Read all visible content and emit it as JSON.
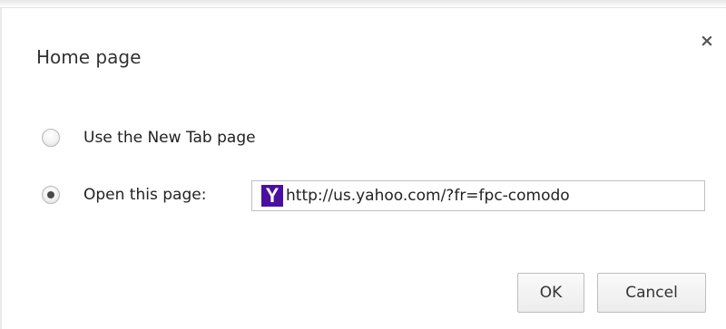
{
  "dialog": {
    "title": "Home page",
    "close_glyph": "×"
  },
  "options": [
    {
      "label": "Use the New Tab page",
      "checked": false
    },
    {
      "label": "Open this page:",
      "checked": true
    }
  ],
  "url_field": {
    "value": "http://us.yahoo.com/?fr=fpc-comodo",
    "favicon": {
      "icon": "yahoo-favicon",
      "glyph": "Y",
      "color": "#4b0fa0"
    }
  },
  "buttons": {
    "ok_label": "OK",
    "cancel_label": "Cancel"
  }
}
